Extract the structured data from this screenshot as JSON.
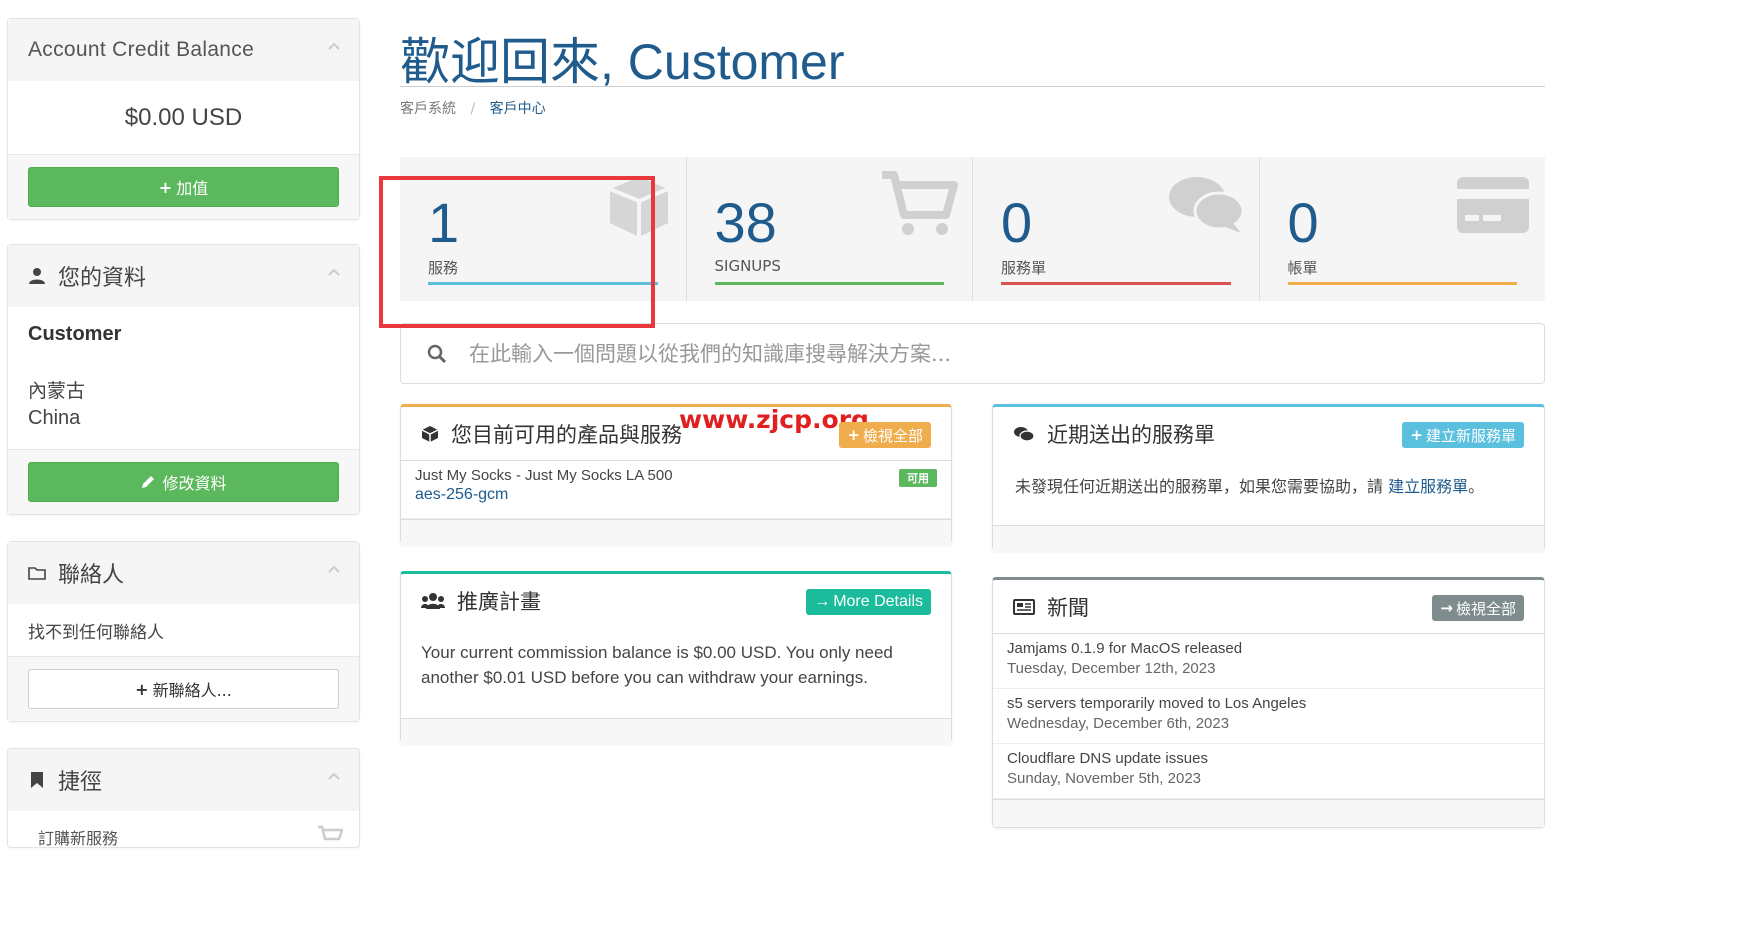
{
  "colors": {
    "brand": "#1f5b8c",
    "green": "#5cb85c",
    "orange": "#f0ad4e",
    "cyan": "#5bc0de",
    "teal": "#1abc9c",
    "gray": "#7f8c8d",
    "red": "#d9534f",
    "highlight": "#e8383d"
  },
  "sidebar": {
    "credit": {
      "title": "Account Credit Balance",
      "amount": "$0.00 USD",
      "button_label": "加值"
    },
    "profile": {
      "title": "您的資料",
      "name": "Customer",
      "region": "內蒙古",
      "country": "China",
      "button_label": "修改資料"
    },
    "contacts": {
      "title": "聯絡人",
      "empty_text": "找不到任何聯絡人",
      "button_label": "新聯絡人..."
    },
    "shortcuts": {
      "title": "捷徑",
      "first_item": "訂購新服務"
    }
  },
  "header": {
    "title_cjk": "歡迎回來",
    "title_latin": ", Customer",
    "breadcrumb": [
      "客戶系統",
      "客戶中心"
    ]
  },
  "tiles": [
    {
      "value": "1",
      "label": "服務",
      "icon": "cube-icon",
      "bar_color": "#5bc0de"
    },
    {
      "value": "38",
      "label": "SIGNUPS",
      "icon": "cart-icon",
      "bar_color": "#5cb85c"
    },
    {
      "value": "0",
      "label": "服務單",
      "icon": "comments-icon",
      "bar_color": "#d9534f"
    },
    {
      "value": "0",
      "label": "帳單",
      "icon": "credit-card-icon",
      "bar_color": "#f0ad4e"
    }
  ],
  "search": {
    "placeholder": "在此輸入一個問題以從我們的知識庫搜尋解決方案..."
  },
  "services_card": {
    "title": "您目前可用的產品與服務",
    "button_label": "檢視全部",
    "watermark": "www.zjcp.org",
    "items": [
      {
        "name": "Just My Socks - Just My Socks LA 500",
        "detail": "aes-256-gcm",
        "status": "可用"
      }
    ]
  },
  "affiliate_card": {
    "title": "推廣計畫",
    "button_label": "More Details",
    "text": "Your current commission balance is $0.00 USD. You only need another $0.01 USD before you can withdraw your earnings."
  },
  "tickets_card": {
    "title": "近期送出的服務單",
    "button_label": "建立新服務單",
    "text_before": "未發現任何近期送出的服務單，如果您需要協助，請 ",
    "link_text": "建立服務單",
    "text_after": "。"
  },
  "news_card": {
    "title": "新聞",
    "button_label": "檢視全部",
    "items": [
      {
        "title": "Jamjams 0.1.9 for MacOS released",
        "date": "Tuesday, December 12th, 2023"
      },
      {
        "title": "s5 servers temporarily moved to Los Angeles",
        "date": "Wednesday, December 6th, 2023"
      },
      {
        "title": "Cloudflare DNS update issues",
        "date": "Sunday, November 5th, 2023"
      }
    ]
  }
}
